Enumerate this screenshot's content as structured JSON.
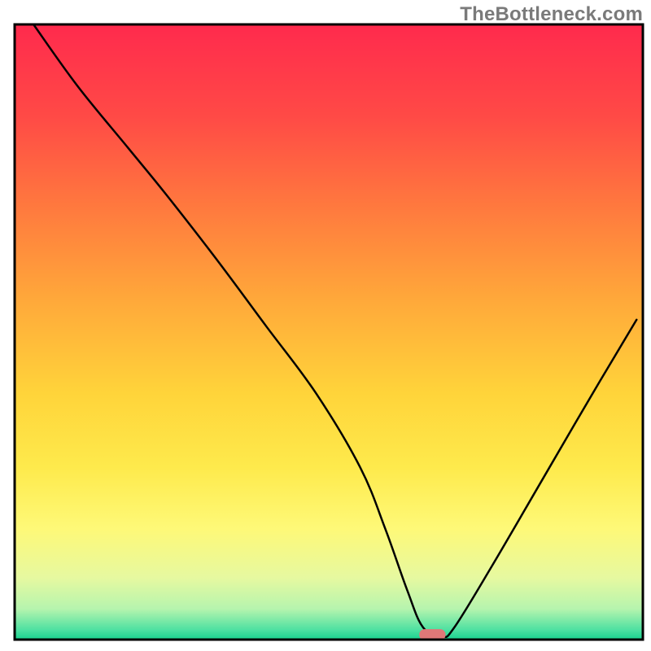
{
  "watermark": "TheBottleneck.com",
  "chart_data": {
    "type": "line",
    "title": "",
    "xlabel": "",
    "ylabel": "",
    "xlim": [
      0,
      100
    ],
    "ylim": [
      0,
      100
    ],
    "grid": false,
    "legend": false,
    "background": {
      "type": "vertical-gradient",
      "stops": [
        {
          "pos": 0.0,
          "color": "#ff2a4d"
        },
        {
          "pos": 0.15,
          "color": "#ff4a46"
        },
        {
          "pos": 0.3,
          "color": "#ff7a3e"
        },
        {
          "pos": 0.45,
          "color": "#ffa93a"
        },
        {
          "pos": 0.6,
          "color": "#ffd43a"
        },
        {
          "pos": 0.72,
          "color": "#feea4c"
        },
        {
          "pos": 0.82,
          "color": "#fef978"
        },
        {
          "pos": 0.9,
          "color": "#e6f9a0"
        },
        {
          "pos": 0.95,
          "color": "#b6f4ae"
        },
        {
          "pos": 0.985,
          "color": "#4be0a1"
        },
        {
          "pos": 1.0,
          "color": "#18d28e"
        }
      ]
    },
    "series": [
      {
        "name": "bottleneck-curve",
        "stroke": "#000000",
        "stroke_width": 2.5,
        "x": [
          3.0,
          10.0,
          18.0,
          24.0,
          32.0,
          40.0,
          48.0,
          55.0,
          59.0,
          62.5,
          65.0,
          68.0,
          70.0,
          76.0,
          84.0,
          92.0,
          99.0
        ],
        "y": [
          100.0,
          90.0,
          80.0,
          72.5,
          62.0,
          51.0,
          40.0,
          28.0,
          18.0,
          8.0,
          2.0,
          0.5,
          2.0,
          12.0,
          26.0,
          40.0,
          52.0
        ]
      }
    ],
    "marker": {
      "name": "optimum-marker",
      "shape": "capsule",
      "cx": 66.5,
      "cy": 0.8,
      "width": 4.2,
      "height": 1.8,
      "fill": "#e07878"
    },
    "frame": {
      "stroke": "#000000",
      "stroke_width": 3
    }
  }
}
